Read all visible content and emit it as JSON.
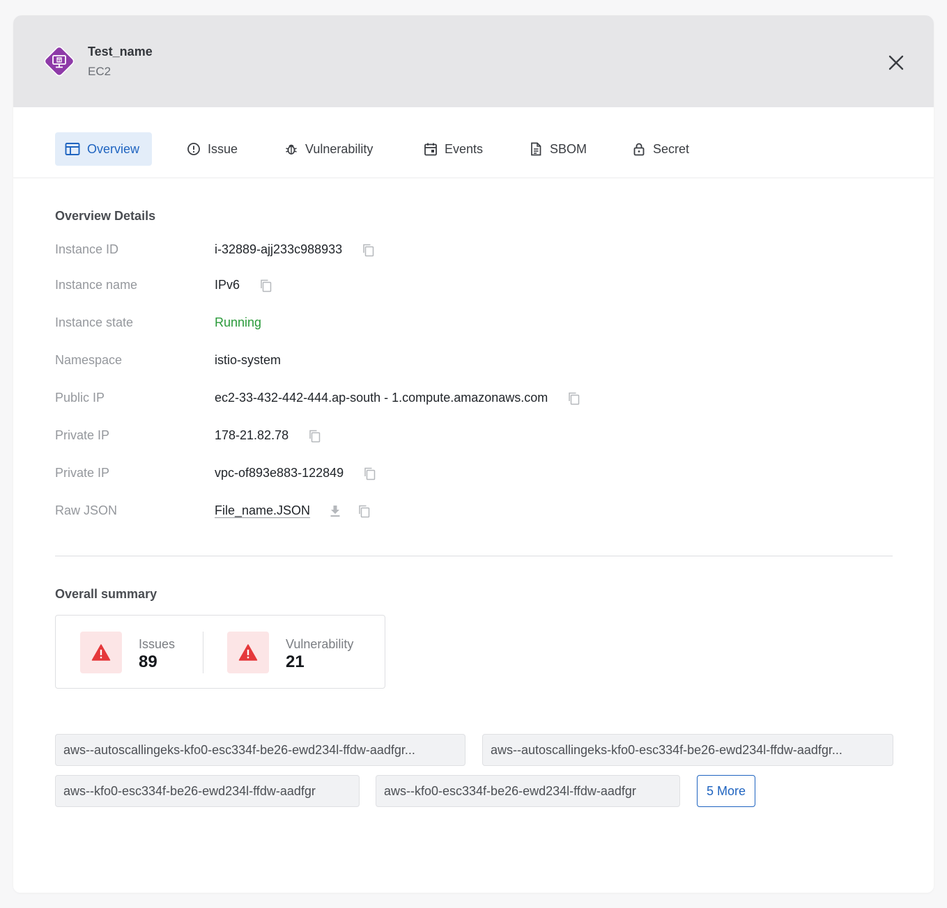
{
  "header": {
    "title": "Test_name",
    "subtitle": "EC2",
    "icon": "monitor-box-icon",
    "icon_color": "#8e3aa8",
    "close_icon": "close-icon"
  },
  "tabs": [
    {
      "label": "Overview",
      "icon": "table-layout-icon",
      "active": true
    },
    {
      "label": "Issue",
      "icon": "alert-circle-icon",
      "active": false
    },
    {
      "label": "Vulnerability",
      "icon": "bug-icon",
      "active": false
    },
    {
      "label": "Events",
      "icon": "calendar-icon",
      "active": false
    },
    {
      "label": "SBOM",
      "icon": "document-icon",
      "active": false
    },
    {
      "label": "Secret",
      "icon": "lock-icon",
      "active": false
    }
  ],
  "overview": {
    "title": "Overview Details",
    "rows": [
      {
        "label": "Instance ID",
        "value": "i-32889-ajj233c988933"
      },
      {
        "label": "Instance name",
        "value": "IPv6"
      },
      {
        "label": "Instance state",
        "value": "Running"
      },
      {
        "label": "Namespace",
        "value": "istio-system"
      },
      {
        "label": "Public IP",
        "value": "ec2-33-432-442-444.ap-south - 1.compute.amazonaws.com"
      },
      {
        "label": "Private IP",
        "value": "178-21.82.78"
      },
      {
        "label": "Private IP",
        "value": "vpc-of893e883-122849"
      },
      {
        "label": "Raw JSON",
        "value": "File_name.JSON"
      }
    ]
  },
  "summary": {
    "title": "Overall summary",
    "issues_label": "Issues",
    "issues_value": "89",
    "vuln_label": "Vulnerability",
    "vuln_value": "21",
    "warn_color": "#e5383b"
  },
  "tags": [
    "aws--autoscallingeks-kfo0-esc334f-be26-ewd234l-ffdw-aadfgr...",
    "aws--autoscallingeks-kfo0-esc334f-be26-ewd234l-ffdw-aadfgr...",
    "aws--kfo0-esc334f-be26-ewd234l-ffdw-aadfgr",
    "aws--kfo0-esc334f-be26-ewd234l-ffdw-aadfgr"
  ],
  "more_label": "5 More",
  "colors": {
    "accent": "#1f64c0",
    "running": "#2a9a3a",
    "header_bg": "#e6e6e8"
  }
}
